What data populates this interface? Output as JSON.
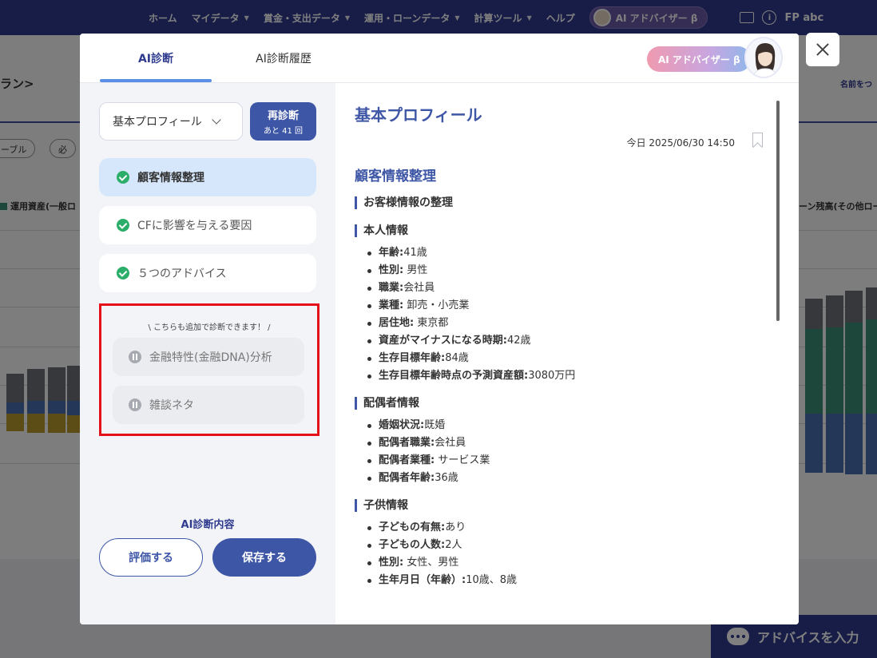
{
  "nav": {
    "items": [
      "ホーム",
      "マイデータ",
      "賞金・支出データ",
      "運用・ローンデータ",
      "計算ツール",
      "ヘルプ"
    ],
    "ai_label": "AI アドバイザー β",
    "user": "FP abc"
  },
  "background": {
    "plan_title": "ラン>",
    "tabs": [
      "ーブル",
      "必"
    ],
    "legend_left": "運用資産(一般ロ",
    "legend_right": "ーン残高(その他ロー",
    "name_link": "名前をつ",
    "advice_button": "アドバイスを入力"
  },
  "modal": {
    "tabs": {
      "diagnosis": "AI診断",
      "history": "AI診断履歴"
    },
    "ai_badge": "AI アドバイザー β",
    "left": {
      "select_value": "基本プロフィール",
      "rediag_label": "再診断",
      "rediag_remaining": "あと 41 回",
      "steps": [
        {
          "label": "顧客情報整理",
          "active": true
        },
        {
          "label": "CFに影響を与える要因",
          "active": false
        },
        {
          "label": "５つのアドバイス",
          "active": false
        }
      ],
      "extra_note": "\\ こちらも追加で診断できます！ /",
      "extra_items": [
        "金融特性(金融DNA)分析",
        "雑談ネタ"
      ],
      "content_label": "AI診断内容",
      "eval_button": "評価する",
      "save_button": "保存する"
    },
    "right": {
      "title": "基本プロフィール",
      "date": "今日 2025/06/30 14:50",
      "section": "顧客情報整理",
      "customer_heading": "お客様情報の整理",
      "self_heading": "本人情報",
      "self_items": [
        {
          "k": "年齢:",
          "v": "41歳"
        },
        {
          "k": "性別:",
          "v": " 男性"
        },
        {
          "k": "職業:",
          "v": "会社員"
        },
        {
          "k": "業種:",
          "v": " 卸売・小売業"
        },
        {
          "k": "居住地:",
          "v": " 東京都"
        },
        {
          "k": "資産がマイナスになる時期:",
          "v": "42歳"
        },
        {
          "k": "生存目標年齢:",
          "v": "84歳"
        },
        {
          "k": "生存目標年齢時点の予測資産額:",
          "v": "3080万円"
        }
      ],
      "spouse_heading": "配偶者情報",
      "spouse_items": [
        {
          "k": "婚姻状況:",
          "v": "既婚"
        },
        {
          "k": "配偶者職業:",
          "v": "会社員"
        },
        {
          "k": "配偶者業種:",
          "v": " サービス業"
        },
        {
          "k": "配偶者年齢:",
          "v": "36歳"
        }
      ],
      "child_heading": "子供情報",
      "child_items": [
        {
          "k": "子どもの有無:",
          "v": "あり"
        },
        {
          "k": "子どもの人数:",
          "v": "2人"
        },
        {
          "k": "性別:",
          "v": " 女性、男性"
        },
        {
          "k": "生年月日（年齢）:",
          "v": "10歳、8歳"
        }
      ]
    }
  }
}
